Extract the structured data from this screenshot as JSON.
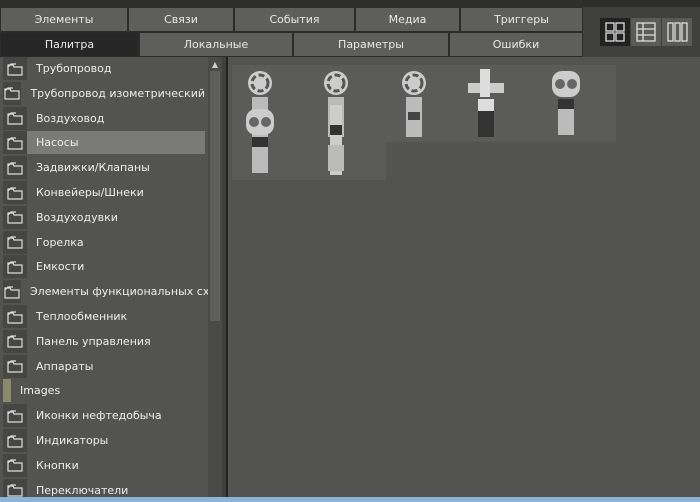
{
  "tabs_row1": [
    "Элементы",
    "Связи",
    "События",
    "Медиа",
    "Триггеры"
  ],
  "tabs_row2": [
    "Палитра",
    "Локальные",
    "Параметры",
    "Ошибки"
  ],
  "active_tab": "Палитра",
  "view_modes": [
    "grid-view",
    "table-view",
    "columns-view"
  ],
  "tree": {
    "items": [
      {
        "label": "Трубопровод",
        "icon": "folder-icon"
      },
      {
        "label": "Трубопровод изометрический",
        "icon": "folder-icon"
      },
      {
        "label": "Воздуховод",
        "icon": "folder-icon"
      },
      {
        "label": "Насосы",
        "icon": "folder-icon",
        "selected": true
      },
      {
        "label": "Задвижки/Клапаны",
        "icon": "folder-icon"
      },
      {
        "label": "Конвейеры/Шнеки",
        "icon": "folder-icon"
      },
      {
        "label": "Воздуходувки",
        "icon": "folder-icon"
      },
      {
        "label": "Горелка",
        "icon": "folder-icon"
      },
      {
        "label": "Емкости",
        "icon": "folder-icon"
      },
      {
        "label": "Элементы функциональных схем",
        "icon": "folder-icon"
      },
      {
        "label": "Теплообменник",
        "icon": "folder-icon"
      },
      {
        "label": "Панель управления",
        "icon": "folder-icon"
      },
      {
        "label": "Аппараты",
        "icon": "folder-icon"
      },
      {
        "label": "Images",
        "icon": "file-icon"
      },
      {
        "label": "Иконки нефтедобыча",
        "icon": "folder-icon"
      },
      {
        "label": "Индикаторы",
        "icon": "folder-icon"
      },
      {
        "label": "Кнопки",
        "icon": "folder-icon"
      },
      {
        "label": "Переключатели",
        "icon": "folder-icon"
      }
    ]
  },
  "palette_items": [
    "centrifugal-pump",
    "centrifugal-pump-small",
    "blower-pump",
    "inline-pump",
    "gear-pump-vertical",
    "gear-pump",
    "submersible-pump"
  ]
}
